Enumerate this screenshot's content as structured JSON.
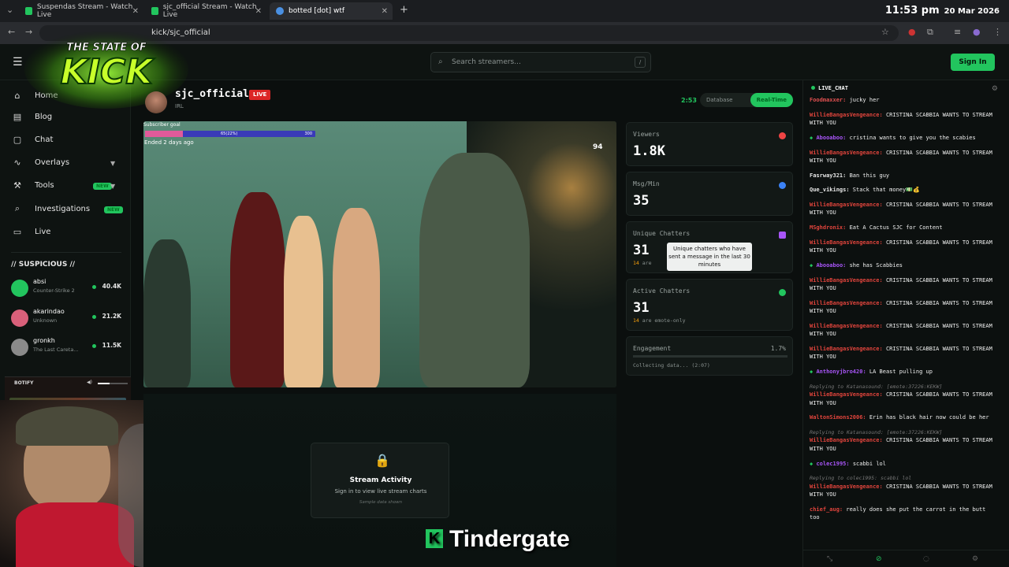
{
  "browser": {
    "tabs": [
      {
        "title": "Suspendas Stream - Watch Live",
        "color": "#22c55e"
      },
      {
        "title": "sjc_official Stream - Watch Live",
        "color": "#22c55e"
      },
      {
        "title": "botted [dot] wtf",
        "color": "#4a90e2"
      }
    ],
    "url": "kick/sjc_official",
    "clock_time": "11:53 pm",
    "clock_date": "20 Mar 2026"
  },
  "header": {
    "search_placeholder": "Search streamers...",
    "search_shortcut": "/",
    "signin_label": "Sign In"
  },
  "logo": {
    "line1": "THE STATE OF",
    "line2": "KICK"
  },
  "sidebar": {
    "items": [
      {
        "label": "Home",
        "icon": "home-icon"
      },
      {
        "label": "Blog",
        "icon": "document-icon"
      },
      {
        "label": "Chat",
        "icon": "chat-bubble-icon"
      },
      {
        "label": "Overlays",
        "icon": "activity-icon"
      },
      {
        "label": "Tools",
        "icon": "wrench-icon",
        "badge": "NEW"
      },
      {
        "label": "Investigations",
        "icon": "search-icon",
        "badge": "NEW"
      },
      {
        "label": "Live",
        "icon": "tv-icon"
      }
    ],
    "suspicious_title": "// SUSPICIOUS //",
    "suspicious": [
      {
        "name": "absi",
        "game": "Counter-Strike 2",
        "count": "40.4K",
        "color": "#22c55e"
      },
      {
        "name": "akarindao",
        "game": "Unknown",
        "count": "21.2K",
        "color": "#d9607a"
      },
      {
        "name": "gronkh",
        "game": "The Last Careta...",
        "count": "11.5K",
        "color": "#8a8a8a"
      }
    ]
  },
  "botify": {
    "title": "BOTIFY"
  },
  "stream": {
    "name": "sjc_official",
    "live_label": "LIVE",
    "category": "IRL",
    "uptime": "2:53",
    "mode_database": "Database",
    "mode_realtime": "Real-Time",
    "subgoal_label": "Subscriber goal",
    "subgoal_progress": "65(22%)",
    "subgoal_fraction": 0.22,
    "subgoal_target": "300",
    "subgoal_ended": "Ended 2 days ago",
    "video_counter": "94"
  },
  "stats": {
    "viewers": {
      "label": "Viewers",
      "value": "1.8K",
      "color": "#ef4444"
    },
    "msgmin": {
      "label": "Msg/Min",
      "value": "35",
      "color": "#3b82f6"
    },
    "unique": {
      "label": "Unique Chatters",
      "value": "31",
      "sub_count": "14",
      "sub_text": "are",
      "color": "#a855f7"
    },
    "tooltip": "Unique chatters who have sent a message in the last 30 minutes",
    "active": {
      "label": "Active Chatters",
      "value": "31",
      "sub_count": "14",
      "sub_text": "are emote-only",
      "color": "#22c55e"
    },
    "engagement": {
      "label": "Engagement",
      "value": "1.7%",
      "collecting": "Collecting data... (2:07)"
    }
  },
  "locked_chart": {
    "title": "Stream Activity",
    "subtitle": "Sign in to view live stream charts",
    "note": "Sample data shown"
  },
  "caption": {
    "badge": "K",
    "text": "Tindergate"
  },
  "chat": {
    "title": "LIVE_CHAT",
    "messages": [
      {
        "user": "Foodmaxxer:",
        "text": "jucky her",
        "color": "#e05050"
      },
      {
        "user": "WillieBangasVengeance:",
        "text": "CRISTINA SCABBIA WANTS TO STREAM WITH YOU",
        "color": "#e0443c"
      },
      {
        "user": "Abooaboo:",
        "text": "cristina wants to give you the scabies",
        "color": "#a855f7",
        "gem": true
      },
      {
        "user": "WillieBangasVengeance:",
        "text": "CRISTINA SCABBIA WANTS TO STREAM WITH YOU",
        "color": "#e0443c"
      },
      {
        "user": "Fasrway321:",
        "text": "Ban this guy",
        "color": "#e6e6e6"
      },
      {
        "user": "Que_vikings:",
        "text": "Stack that money💵💰",
        "color": "#e6e6e6"
      },
      {
        "user": "WillieBangasVengeance:",
        "text": "CRISTINA SCABBIA WANTS TO STREAM WITH YOU",
        "color": "#e0443c"
      },
      {
        "user": "MSghdronix:",
        "text": "Eat A Cactus SJC for Content",
        "color": "#e0443c"
      },
      {
        "user": "WillieBangasVengeance:",
        "text": "CRISTINA SCABBIA WANTS TO STREAM WITH YOU",
        "color": "#e0443c"
      },
      {
        "user": "Abooaboo:",
        "text": "she has Scabbies",
        "color": "#a855f7",
        "gem": true
      },
      {
        "user": "WillieBangasVengeance:",
        "text": "CRISTINA SCABBIA WANTS TO STREAM WITH YOU",
        "color": "#e0443c"
      },
      {
        "user": "WillieBangasVengeance:",
        "text": "CRISTINA SCABBIA WANTS TO STREAM WITH YOU",
        "color": "#e0443c"
      },
      {
        "user": "WillieBangasVengeance:",
        "text": "CRISTINA SCABBIA WANTS TO STREAM WITH YOU",
        "color": "#e0443c"
      },
      {
        "user": "WillieBangasVengeance:",
        "text": "CRISTINA SCABBIA WANTS TO STREAM WITH YOU",
        "color": "#e0443c"
      },
      {
        "user": "Anthonyjbro420:",
        "text": "LA Beast pulling up",
        "color": "#a855f7",
        "gem": true
      },
      {
        "reply": "Replying to Katanasound: [emote:37226:KEKW]",
        "user": "WillieBangasVengeance:",
        "text": "CRISTINA SCABBIA WANTS TO STREAM WITH YOU",
        "color": "#e0443c"
      },
      {
        "user": "WaltonSimons2006:",
        "text": "Erin has black hair now could be her",
        "color": "#e0443c"
      },
      {
        "reply": "Replying to Katanasound: [emote:37226:KEKW]",
        "user": "WillieBangasVengeance:",
        "text": "CRISTINA SCABBIA WANTS TO STREAM WITH YOU",
        "color": "#e0443c"
      },
      {
        "user": "colec1995:",
        "text": "scabbi lol",
        "color": "#a855f7",
        "gem": true
      },
      {
        "reply": "Replying to colec1995: scabbi lol",
        "user": "WillieBangasVengeance:",
        "text": "CRISTINA SCABBIA WANTS TO STREAM WITH YOU",
        "color": "#e0443c"
      },
      {
        "user": "chief_aug:",
        "text": "really does she put the carrot in the butt too",
        "color": "#e0443c"
      }
    ]
  }
}
